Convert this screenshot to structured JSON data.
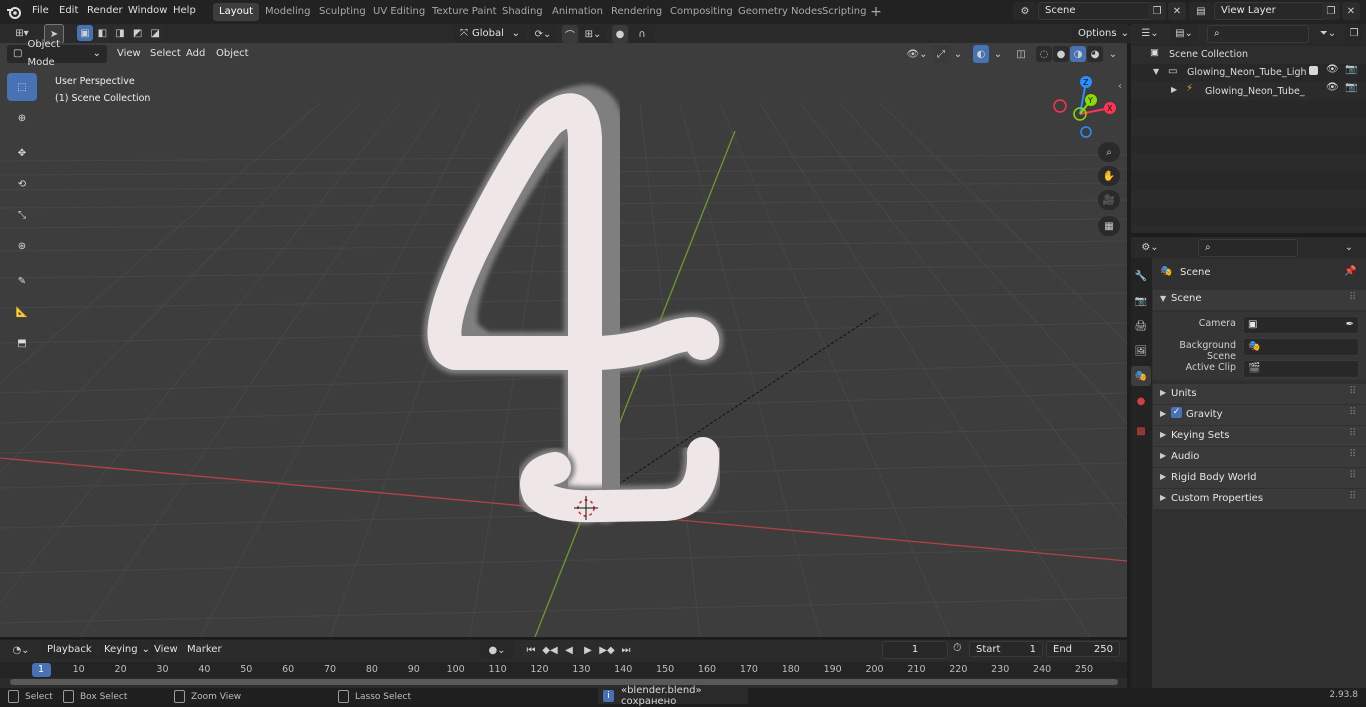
{
  "menus": [
    "File",
    "Edit",
    "Render",
    "Window",
    "Help"
  ],
  "workspace_tabs": [
    "Layout",
    "Modeling",
    "Sculpting",
    "UV Editing",
    "Texture Paint",
    "Shading",
    "Animation",
    "Rendering",
    "Compositing",
    "Geometry Nodes",
    "Scripting"
  ],
  "active_tab": "Layout",
  "scene_name": "Scene",
  "view_layer": "View Layer",
  "header": {
    "mode": "Object Mode",
    "view": "View",
    "select": "Select",
    "add": "Add",
    "object": "Object",
    "transform": "Global",
    "options": "Options"
  },
  "viewport": {
    "perspective": "User Perspective",
    "collection": "(1) Scene Collection"
  },
  "gizmo": {
    "x": "X",
    "y": "Y",
    "z": "Z"
  },
  "outliner": {
    "root": "Scene Collection",
    "items": [
      "Glowing_Neon_Tube_Light_Di",
      "Glowing_Neon_Tube_Ligl"
    ]
  },
  "properties": {
    "breadcrumb": "Scene",
    "panel": "Scene",
    "camera_label": "Camera",
    "bg_scene_label": "Background Scene",
    "active_clip_label": "Active Clip",
    "sections": [
      "Units",
      "Gravity",
      "Keying Sets",
      "Audio",
      "Rigid Body World",
      "Custom Properties"
    ]
  },
  "timeline": {
    "playback": "Playback",
    "keying": "Keying",
    "view": "View",
    "marker": "Marker",
    "current_frame": "1",
    "start_label": "Start",
    "start": "1",
    "end_label": "End",
    "end": "250",
    "ruler": [
      "1",
      "10",
      "20",
      "30",
      "40",
      "50",
      "60",
      "70",
      "80",
      "90",
      "100",
      "110",
      "120",
      "130",
      "140",
      "150",
      "160",
      "170",
      "180",
      "190",
      "200",
      "210",
      "220",
      "230",
      "240",
      "250"
    ]
  },
  "status": {
    "select": "Select",
    "box_select": "Box Select",
    "zoom_view": "Zoom View",
    "lasso_select": "Lasso Select",
    "message": "«blender.blend» сохранено",
    "version": "2.93.8"
  },
  "colors": {
    "accent": "#4772b3",
    "x_axis": "#ff3352",
    "y_axis": "#8bdc00",
    "z_axis": "#2890ff"
  }
}
